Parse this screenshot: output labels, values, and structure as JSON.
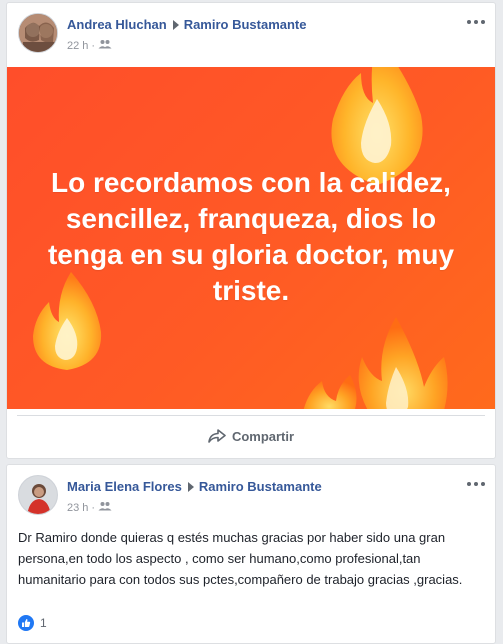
{
  "post1": {
    "author": "Andrea Hluchan",
    "target": "Ramiro Bustamante",
    "time": "22 h",
    "audience_icon": "friends-icon",
    "banner_text": "Lo recordamos con la calidez, sencillez, franqueza, dios lo tenga en su gloria doctor, muy triste.",
    "banner_color": "#ff5226",
    "share_label": "Compartir"
  },
  "post2": {
    "author": "Maria Elena Flores",
    "target": "Ramiro Bustamante",
    "time": "23 h",
    "audience_icon": "friends-icon",
    "body": "Dr Ramiro donde quieras q estés muchas gracias por haber sido una gran persona,en todo los aspecto , como ser humano,como profesional,tan humanitario para con todos sus pctes,compañero de trabajo gracias ,gracias.",
    "like_count": "1",
    "like_color": "#2078f4"
  },
  "colors": {
    "link": "#365899",
    "meta": "#90949c",
    "background": "#e9ebee"
  }
}
